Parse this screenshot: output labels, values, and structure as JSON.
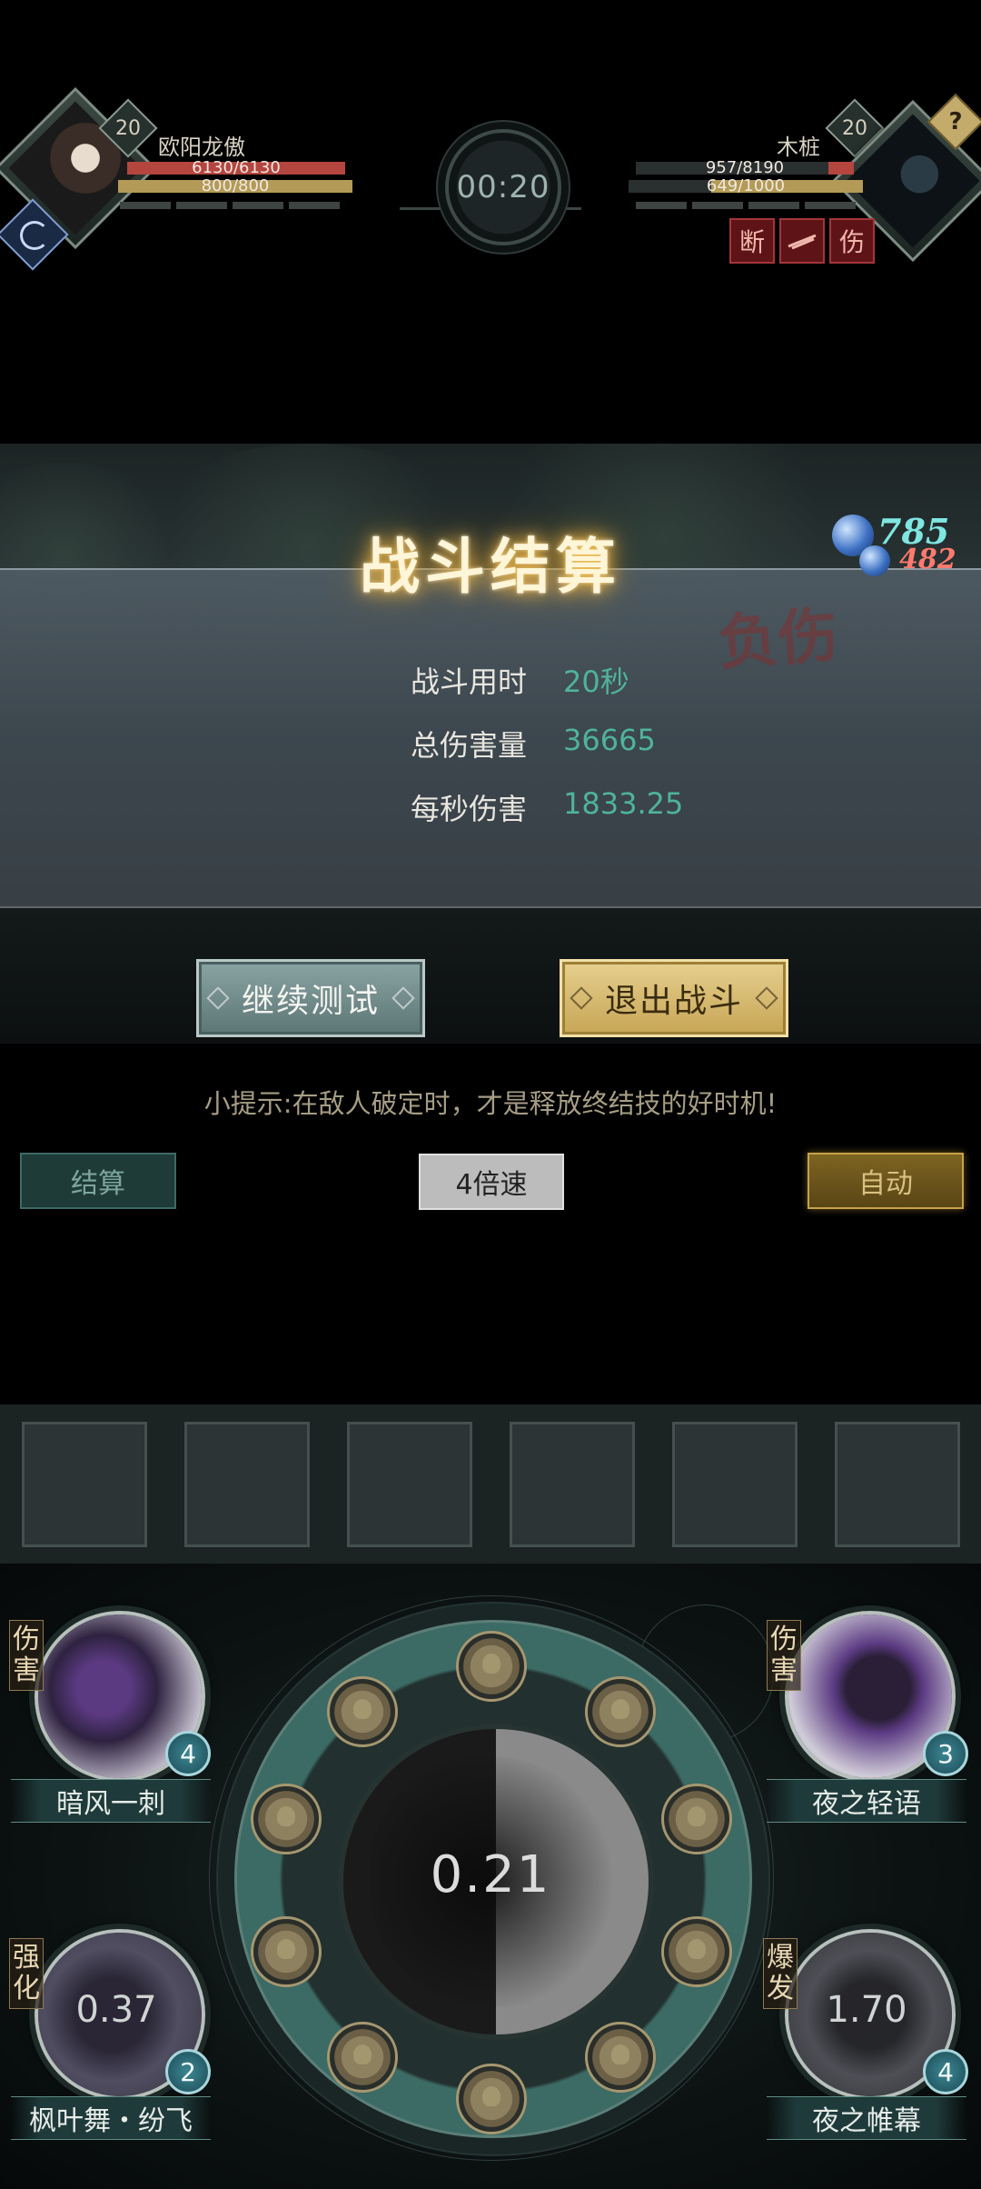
{
  "player": {
    "name": "欧阳龙傲",
    "level": "20",
    "hp_text": "6130/6130",
    "mp_text": "800/800",
    "hp_fraction": 1.0,
    "mp_fraction": 1.0
  },
  "enemy": {
    "name": "木桩",
    "level": "20",
    "hp_text": "957/8190",
    "mp_text": "649/1000",
    "hp_fraction": 0.117,
    "mp_fraction": 0.649,
    "unknown_badge": "?",
    "status_icons": [
      "断",
      "伤"
    ]
  },
  "timer": "00:20",
  "result": {
    "title": "战斗结算",
    "overlay_text": "负伤",
    "counter_top": "785",
    "counter_bottom": "482",
    "stats": [
      {
        "label": "战斗用时",
        "value": "20秒"
      },
      {
        "label": "总伤害量",
        "value": "36665"
      },
      {
        "label": "每秒伤害",
        "value": "1833.25"
      }
    ],
    "continue_label": "继续测试",
    "exit_label": "退出战斗"
  },
  "hint": "小提示:在敌人破定时，才是释放终结技的好时机!",
  "controls": {
    "settle_label": "结算",
    "speed_label": "4倍速",
    "auto_label": "自动"
  },
  "center_wheel": {
    "value": "0.21"
  },
  "skills": {
    "top_left": {
      "tag": "伤害",
      "name": "暗风一刺",
      "count": "4",
      "cooldown": ""
    },
    "top_right": {
      "tag": "伤害",
      "name": "夜之轻语",
      "count": "3",
      "cooldown": ""
    },
    "bottom_left": {
      "tag": "强化",
      "name": "枫叶舞・纷飞",
      "count": "2",
      "cooldown": "0.37"
    },
    "bottom_right": {
      "tag": "爆发",
      "name": "夜之帷幕",
      "count": "4",
      "cooldown": "1.70"
    }
  },
  "colors": {
    "hp": "#b4453f",
    "mp": "#b39a56",
    "accent_teal": "#4fb39a",
    "gold": "#c7a656"
  }
}
